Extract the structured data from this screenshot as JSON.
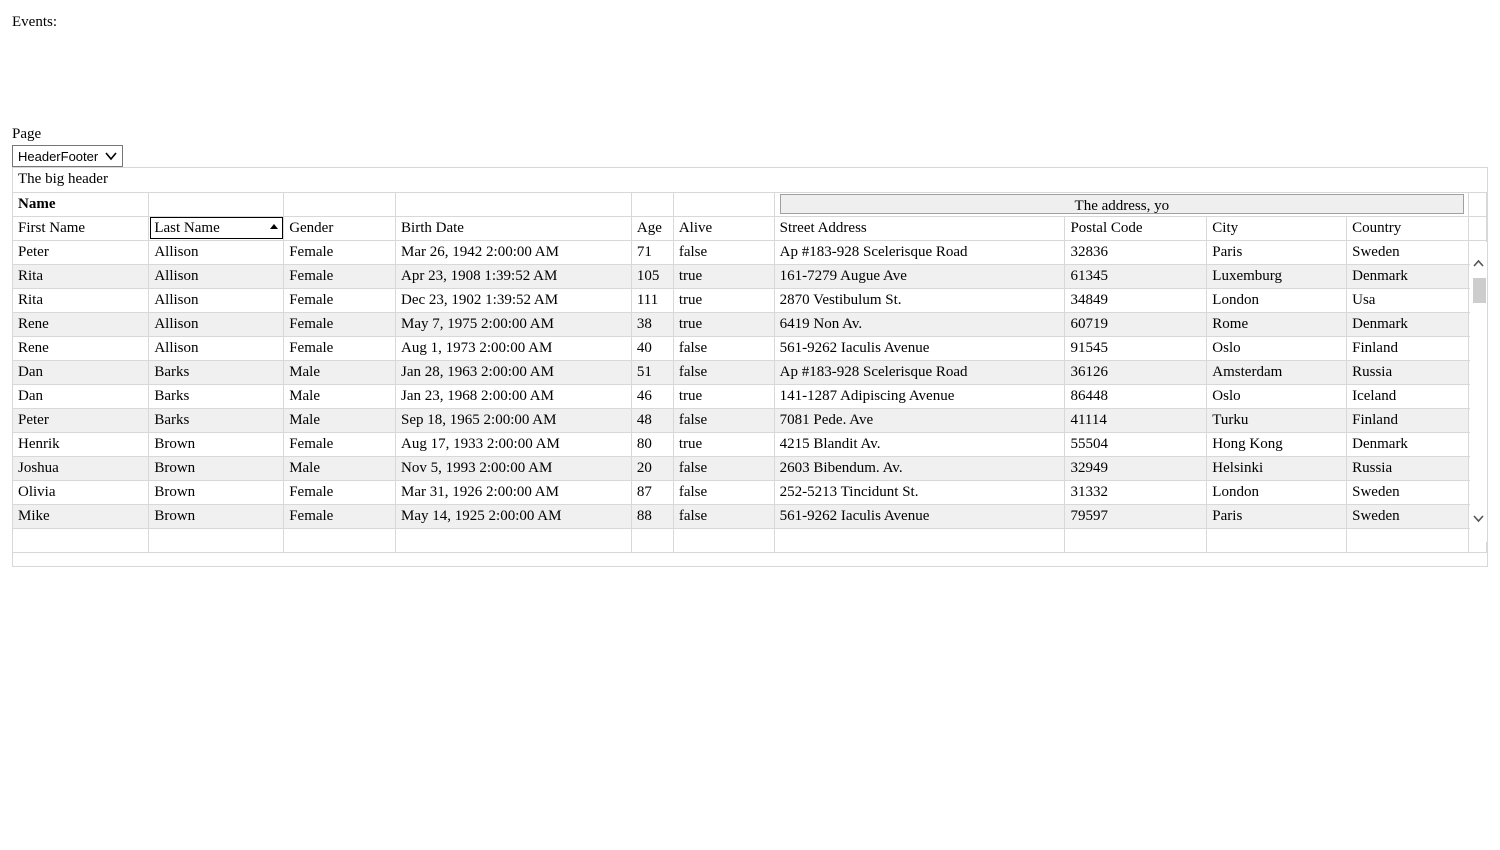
{
  "events_label": "Events:",
  "page_label": "Page",
  "page_select": {
    "selected": "HeaderFooter"
  },
  "grid": {
    "big_header": "The big header",
    "group_name": "Name",
    "group_address": "The address, yo",
    "columns": [
      "First Name",
      "Last Name",
      "Gender",
      "Birth Date",
      "Age",
      "Alive",
      "Street Address",
      "Postal Code",
      "City",
      "Country"
    ],
    "sorted_column": "Last Name",
    "sort_direction": "ascending",
    "rows": [
      [
        "Peter",
        "Allison",
        "Female",
        "Mar 26, 1942 2:00:00 AM",
        "71",
        "false",
        "Ap #183-928 Scelerisque Road",
        "32836",
        "Paris",
        "Sweden"
      ],
      [
        "Rita",
        "Allison",
        "Female",
        "Apr 23, 1908 1:39:52 AM",
        "105",
        "true",
        "161-7279 Augue Ave",
        "61345",
        "Luxemburg",
        "Denmark"
      ],
      [
        "Rita",
        "Allison",
        "Female",
        "Dec 23, 1902 1:39:52 AM",
        "111",
        "true",
        "2870 Vestibulum St.",
        "34849",
        "London",
        "Usa"
      ],
      [
        "Rene",
        "Allison",
        "Female",
        "May 7, 1975 2:00:00 AM",
        "38",
        "true",
        "6419 Non Av.",
        "60719",
        "Rome",
        "Denmark"
      ],
      [
        "Rene",
        "Allison",
        "Female",
        "Aug 1, 1973 2:00:00 AM",
        "40",
        "false",
        "561-9262 Iaculis Avenue",
        "91545",
        "Oslo",
        "Finland"
      ],
      [
        "Dan",
        "Barks",
        "Male",
        "Jan 28, 1963 2:00:00 AM",
        "51",
        "false",
        "Ap #183-928 Scelerisque Road",
        "36126",
        "Amsterdam",
        "Russia"
      ],
      [
        "Dan",
        "Barks",
        "Male",
        "Jan 23, 1968 2:00:00 AM",
        "46",
        "true",
        "141-1287 Adipiscing Avenue",
        "86448",
        "Oslo",
        "Iceland"
      ],
      [
        "Peter",
        "Barks",
        "Male",
        "Sep 18, 1965 2:00:00 AM",
        "48",
        "false",
        "7081 Pede. Ave",
        "41114",
        "Turku",
        "Finland"
      ],
      [
        "Henrik",
        "Brown",
        "Female",
        "Aug 17, 1933 2:00:00 AM",
        "80",
        "true",
        "4215 Blandit Av.",
        "55504",
        "Hong Kong",
        "Denmark"
      ],
      [
        "Joshua",
        "Brown",
        "Male",
        "Nov 5, 1993 2:00:00 AM",
        "20",
        "false",
        "2603 Bibendum. Av.",
        "32949",
        "Helsinki",
        "Russia"
      ],
      [
        "Olivia",
        "Brown",
        "Female",
        "Mar 31, 1926 2:00:00 AM",
        "87",
        "false",
        "252-5213 Tincidunt St.",
        "31332",
        "London",
        "Sweden"
      ],
      [
        "Mike",
        "Brown",
        "Female",
        "May 14, 1925 2:00:00 AM",
        "88",
        "false",
        "561-9262 Iaculis Avenue",
        "79597",
        "Paris",
        "Sweden"
      ]
    ]
  },
  "icons": {
    "select_chevron": "chevron-down-icon",
    "scroll_up": "chevron-up-icon",
    "scroll_down": "chevron-down-icon",
    "sort": "sort-ascending-icon"
  }
}
